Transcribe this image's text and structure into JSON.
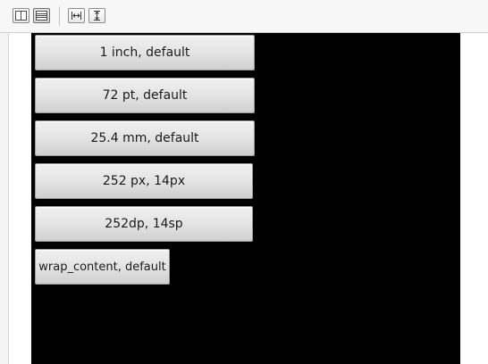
{
  "toolbar": {
    "icons": [
      {
        "name": "split-columns-icon"
      },
      {
        "name": "list-layout-icon",
        "pressed": true
      },
      {
        "name": "fit-width-icon"
      },
      {
        "name": "fit-height-icon"
      }
    ]
  },
  "screen": {
    "background": "#000000",
    "buttons": [
      {
        "label": "1 inch, default"
      },
      {
        "label": "72 pt, default"
      },
      {
        "label": "25.4 mm, default"
      },
      {
        "label": "252 px, 14px"
      },
      {
        "label": "252dp, 14sp"
      },
      {
        "label": "wrap_content, default"
      }
    ]
  }
}
